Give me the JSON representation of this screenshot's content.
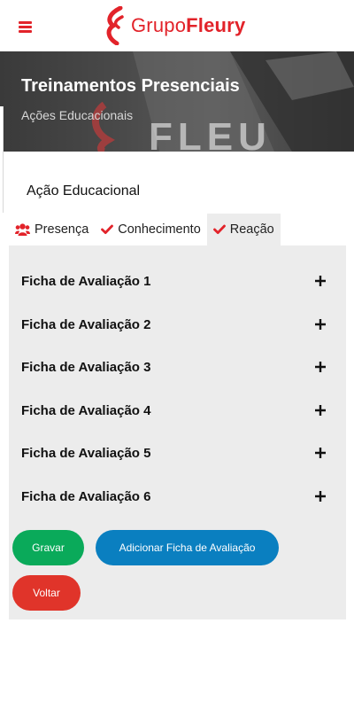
{
  "header": {
    "menu_icon": "hamburger-menu-icon",
    "logo_part1": "Grupo",
    "logo_part2": "Fleury",
    "brand_color": "#e2232a"
  },
  "hero": {
    "title": "Treinamentos Presenciais",
    "subtitle": "Ações Educacionais",
    "background_text": "FLEU"
  },
  "section": {
    "title": "Ação Educacional"
  },
  "tabs": [
    {
      "label": "Presença",
      "icon": "users-icon"
    },
    {
      "label": "Conhecimento",
      "icon": "check-icon"
    },
    {
      "label": "Reação",
      "icon": "check-icon",
      "active": true
    }
  ],
  "accordion": [
    {
      "label": "Ficha de Avaliação 1"
    },
    {
      "label": "Ficha de Avaliação 2"
    },
    {
      "label": "Ficha de Avaliação 3"
    },
    {
      "label": "Ficha de Avaliação 4"
    },
    {
      "label": "Ficha de Avaliação 5"
    },
    {
      "label": "Ficha de Avaliação 6"
    }
  ],
  "buttons": {
    "save": "Gravar",
    "add": "Adicionar Ficha de Avaliação",
    "back": "Voltar"
  },
  "colors": {
    "save": "#0aaa5a",
    "add": "#0a7fc0",
    "back": "#e0342a",
    "check": "#e2232a"
  }
}
